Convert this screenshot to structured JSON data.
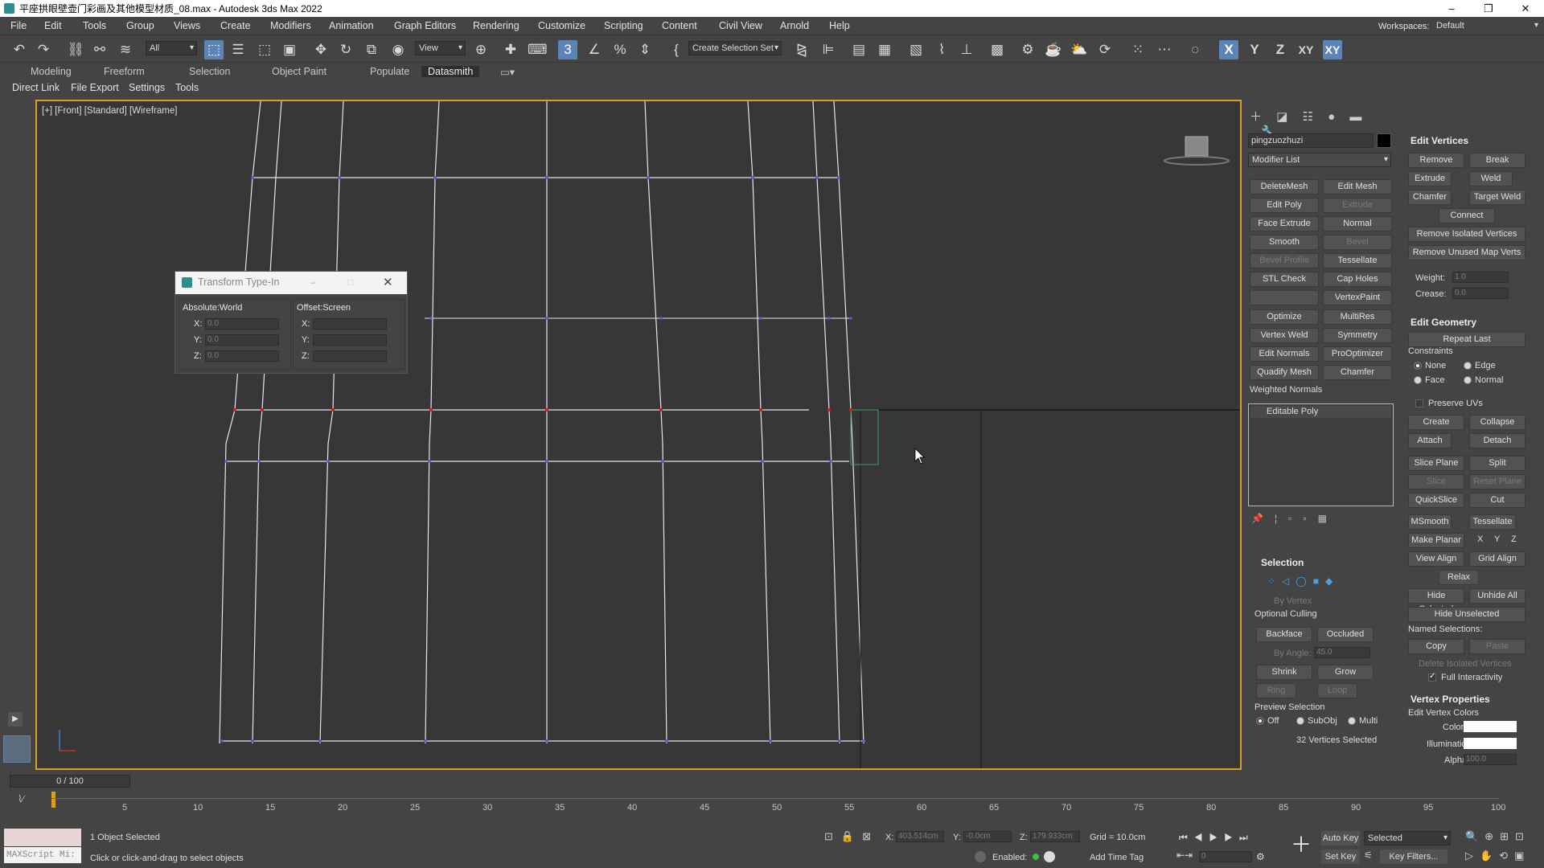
{
  "title": "平座拱眼壁壶门彩画及其他模型材质_08.max - Autodesk 3ds Max 2022",
  "window_controls": [
    "–",
    "❐",
    "✕"
  ],
  "menu": [
    "File",
    "Edit",
    "Tools",
    "Group",
    "Views",
    "Create",
    "Modifiers",
    "Animation",
    "Graph Editors",
    "Rendering",
    "Customize",
    "Scripting",
    "Content",
    "Civil View",
    "Arnold",
    "Help"
  ],
  "workspaces_label": "Workspaces:",
  "workspaces_value": "Default",
  "toolbar": {
    "filter": "All",
    "refcoord": "View",
    "named_selection": "Create Selection Set",
    "axis": [
      "X",
      "Y",
      "Z",
      "XY",
      "XY"
    ]
  },
  "ribbon_tabs": [
    "Modeling",
    "Freeform",
    "Selection",
    "Object Paint",
    "Populate",
    "Datasmith"
  ],
  "ribbon2": [
    "Direct Link",
    "File Export",
    "Settings",
    "Tools"
  ],
  "viewport_label": "[+] [Front] [Standard] [Wireframe]",
  "dialog": {
    "title": "Transform Type-In",
    "abs_label": "Absolute:World",
    "off_label": "Offset:Screen",
    "abs_values": {
      "x": "0.0",
      "y": "0.0",
      "z": "0.0"
    },
    "axes": [
      "X:",
      "Y:",
      "Z:"
    ]
  },
  "command_panel": {
    "object_name": "pingzuozhuzi",
    "modifier_list": "Modifier List",
    "mod_buttons": [
      [
        "DeleteMesh",
        "Edit Mesh"
      ],
      [
        "Edit Poly",
        "Extrude"
      ],
      [
        "Face Extrude",
        "Normal"
      ],
      [
        "Smooth",
        "Bevel"
      ],
      [
        "Bevel Profile",
        "Tessellate"
      ],
      [
        "STL Check",
        "Cap Holes"
      ],
      [
        "",
        "VertexPaint"
      ],
      [
        "Optimize",
        "MultiRes"
      ],
      [
        "Vertex Weld",
        "Symmetry"
      ],
      [
        "Edit Normals",
        "ProOptimizer"
      ],
      [
        "Quadify Mesh",
        "Chamfer"
      ]
    ],
    "weighted_normals": "Weighted Normals",
    "stack_item": "Editable Poly",
    "selection": {
      "title": "Selection",
      "by_vertex": "By Vertex",
      "optional_culling": "Optional Culling",
      "backface": "Backface",
      "occluded": "Occluded",
      "by_angle": "By Angle:",
      "angle_value": "45.0",
      "shrink": "Shrink",
      "grow": "Grow",
      "ring": "Ring",
      "loop": "Loop",
      "preview": "Preview Selection",
      "preview_opts": [
        "Off",
        "SubObj",
        "Multi"
      ],
      "status": "32 Vertices Selected"
    },
    "edit_vertices": {
      "title": "Edit Vertices",
      "buttons": [
        [
          "Remove",
          "Break"
        ],
        [
          "Extrude",
          "Weld"
        ],
        [
          "Chamfer",
          "Target Weld"
        ]
      ],
      "connect": "Connect",
      "remove_isolated": "Remove Isolated Vertices",
      "remove_unused": "Remove Unused Map Verts",
      "weight_label": "Weight:",
      "weight_value": "1.0",
      "crease_label": "Crease:",
      "crease_value": "0.0"
    },
    "edit_geometry": {
      "title": "Edit Geometry",
      "repeat_last": "Repeat Last",
      "constraints": "Constraints",
      "constraint_opts": [
        "None",
        "Edge",
        "Face",
        "Normal"
      ],
      "preserve_uvs": "Preserve UVs",
      "create": "Create",
      "collapse": "Collapse",
      "attach": "Attach",
      "detach": "Detach",
      "slice_plane": "Slice Plane",
      "split": "Split",
      "slice": "Slice",
      "reset_plane": "Reset Plane",
      "quickslice": "QuickSlice",
      "cut": "Cut",
      "msmooth": "MSmooth",
      "tessellate": "Tessellate",
      "make_planar": "Make Planar",
      "xyz": [
        "X",
        "Y",
        "Z"
      ],
      "view_align": "View Align",
      "grid_align": "Grid Align",
      "relax": "Relax",
      "hide_selected": "Hide Selected",
      "unhide_all": "Unhide All",
      "hide_unselected": "Hide Unselected",
      "named_selections": "Named Selections:",
      "copy": "Copy",
      "paste": "Paste",
      "delete_isolated": "Delete Isolated Vertices",
      "full_interactivity": "Full Interactivity"
    },
    "vertex_properties": {
      "title": "Vertex Properties",
      "edit_colors": "Edit Vertex Colors",
      "color": "Color:",
      "illumination": "Illumination:",
      "alpha": "Alpha:",
      "alpha_value": "100.0"
    }
  },
  "timeline": {
    "frame": "0 / 100",
    "ticks": [
      "5",
      "10",
      "15",
      "20",
      "25",
      "30",
      "35",
      "40",
      "45",
      "50",
      "55",
      "60",
      "65",
      "70",
      "75",
      "80",
      "85",
      "90",
      "95",
      "100"
    ]
  },
  "status": {
    "maxscript": "MAXScript Mi:",
    "objects": "1 Object Selected",
    "prompt": "Click or click-and-drag to select objects",
    "x_label": "X:",
    "x_value": "403.514cm",
    "y_label": "Y:",
    "y_value": "-0.0cm",
    "z_label": "Z:",
    "z_value": "179.933cm",
    "grid": "Grid = 10.0cm",
    "enabled": "Enabled:",
    "add_time_tag": "Add Time Tag",
    "auto_key": "Auto Key",
    "auto_key_value": "Selected",
    "set_key": "Set Key",
    "key_filters": "Key Filters...",
    "frame_value": "0"
  }
}
